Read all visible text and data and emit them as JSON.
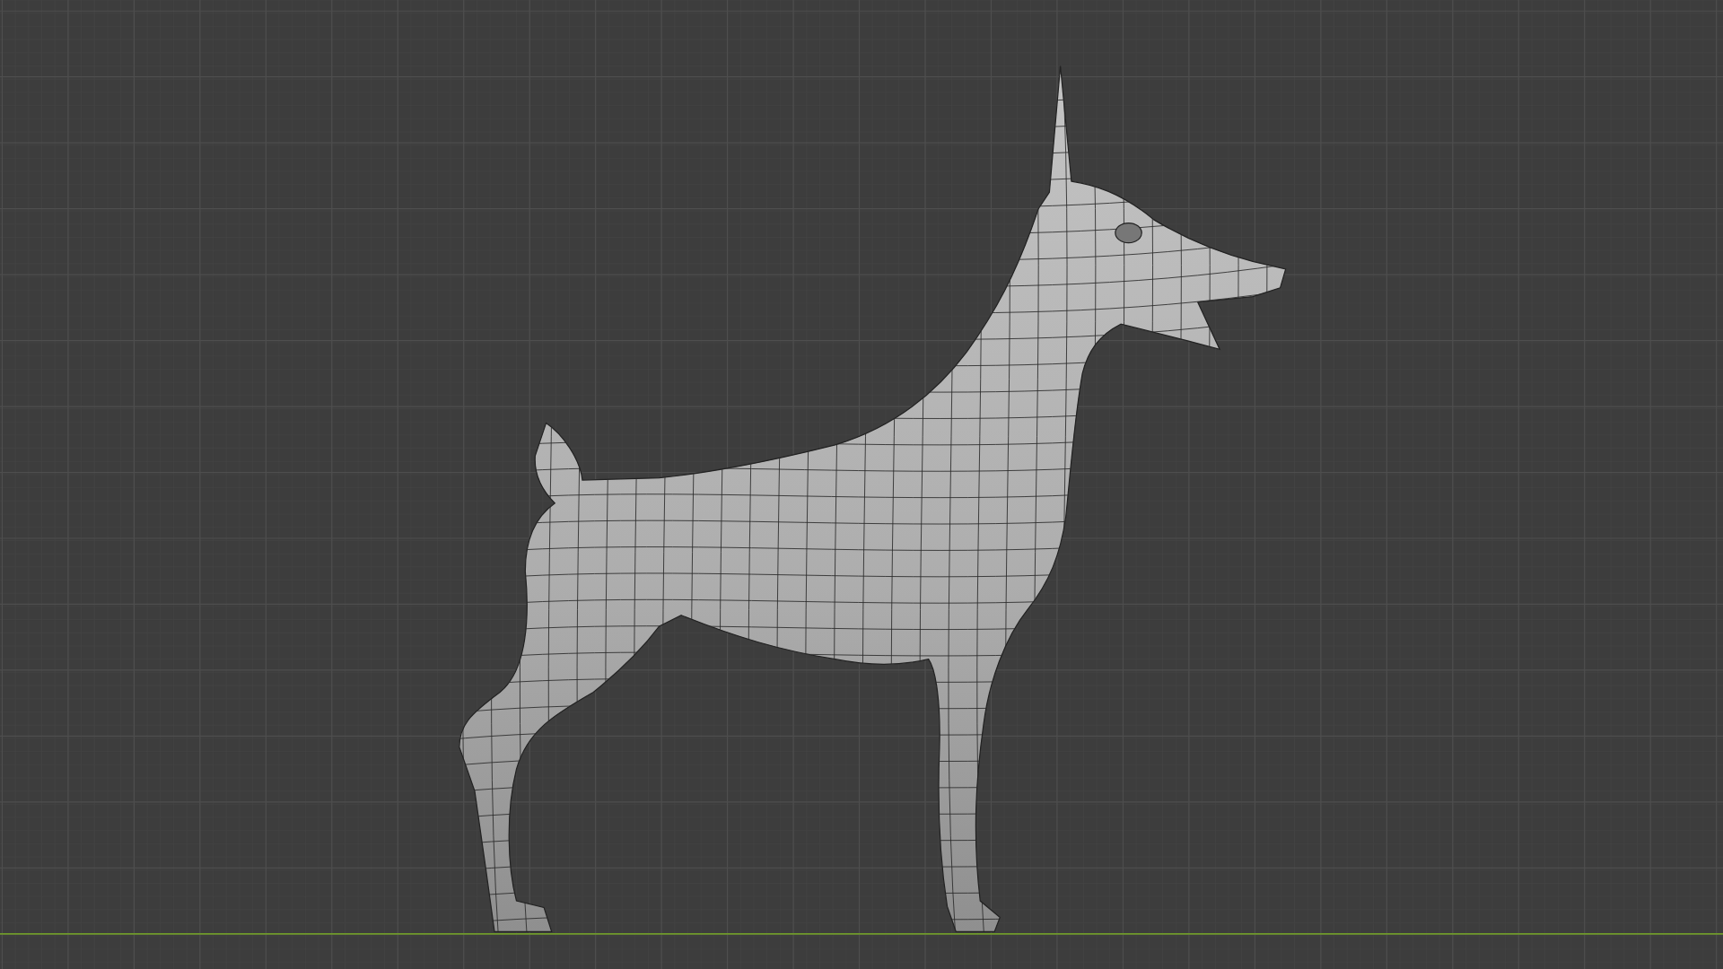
{
  "viewport": {
    "show_grid": true,
    "show_x_axis": true,
    "wireframe_overlay": true
  }
}
